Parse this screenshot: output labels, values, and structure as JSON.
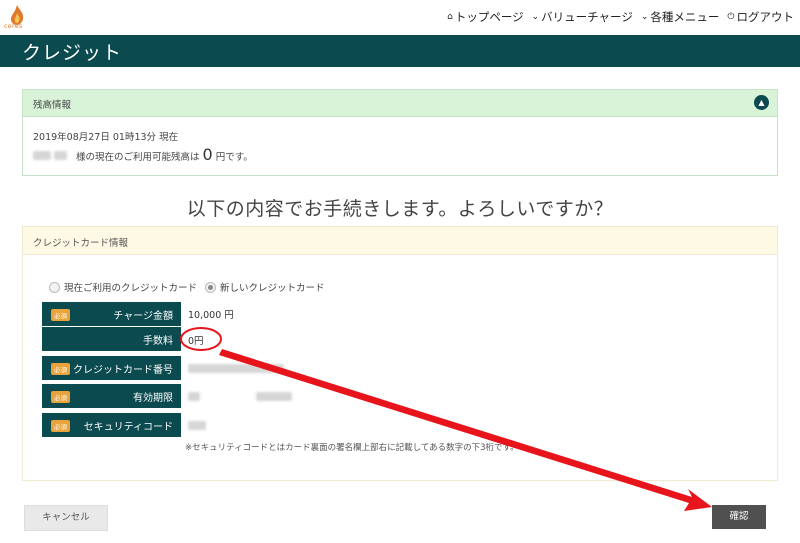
{
  "brand": {
    "logo_text": "ceres"
  },
  "nav": [
    {
      "icon": "home-icon",
      "glyph": "⌂",
      "label": "トップページ"
    },
    {
      "icon": "chevron-down-icon",
      "glyph": "⌄",
      "label": "バリューチャージ"
    },
    {
      "icon": "chevron-down-icon",
      "glyph": "⌄",
      "label": "各種メニュー"
    },
    {
      "icon": "power-icon",
      "glyph": "⏻",
      "label": "ログアウト"
    }
  ],
  "page_title": "クレジット",
  "balance": {
    "header": "残高情報",
    "datetime": "2019年08月27日 01時13分 現在",
    "suffix_before": "様の現在のご利用可能残高は",
    "amount": "0",
    "suffix_after": "円です。"
  },
  "confirm_heading": "以下の内容でお手続きします。よろしいですか？",
  "card": {
    "header": "クレジットカード情報",
    "radio_existing": "現在ご利用のクレジットカード",
    "radio_new": "新しいクレジットカード",
    "required_badge": "必須",
    "rows": {
      "amount_label": "チャージ金額",
      "amount_value": "10,000 円",
      "fee_label": "手数料",
      "fee_value": "0円",
      "card_number_label": "クレジットカード番号",
      "expiry_label": "有効期限",
      "security_label": "セキュリティコード"
    },
    "note": "※セキュリティコードとはカード裏面の署名欄上部右に記載してある数字の下3桁です。"
  },
  "buttons": {
    "cancel": "キャンセル",
    "confirm": "確認"
  },
  "colors": {
    "accent": "#0b4a4e",
    "annotation": "#e8141b",
    "required": "#e8a33a"
  }
}
